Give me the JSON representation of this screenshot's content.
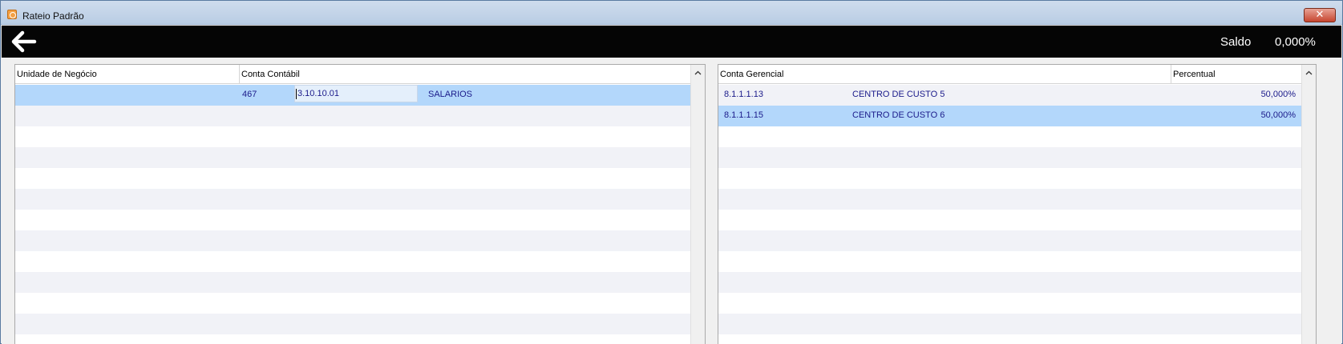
{
  "window": {
    "title": "Rateio Padrão",
    "close_label": "✕"
  },
  "toolbar": {
    "saldo_label": "Saldo",
    "saldo_value": "0,000%"
  },
  "left_grid": {
    "columns": [
      "Unidade de Negócio",
      "Conta Contábil"
    ],
    "rows": [
      {
        "unidade": "",
        "codigo": "467",
        "conta": "3.10.10.01",
        "descricao": "SALARIOS"
      }
    ]
  },
  "right_grid": {
    "columns": [
      "Conta Gerencial",
      "Percentual"
    ],
    "rows": [
      {
        "conta": "8.1.1.1.13",
        "descricao": "CENTRO DE CUSTO 5",
        "percentual": "50,000%"
      },
      {
        "conta": "8.1.1.1.15",
        "descricao": "CENTRO DE CUSTO 6",
        "percentual": "50,000%"
      }
    ]
  },
  "icons": {
    "back": "arrow-left-icon",
    "scroll_up": "chevron-up-icon",
    "app": "app-icon"
  },
  "colors": {
    "selected_row": "#b3d7fb",
    "alt_row": "#f1f2f7",
    "toolbar_bg": "#050505",
    "cell_text": "#1a1a8a"
  }
}
